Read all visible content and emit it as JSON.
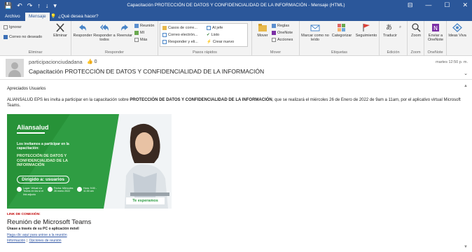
{
  "window": {
    "title": "Capacitación PROTECCIÓN DE DATOS Y CONFIDENCIALIDAD DE LA INFORMACIÓN  -  Mensaje (HTML)",
    "buttons": {
      "minimize": "—",
      "restore": "☐",
      "close": "✕",
      "options": "⊟"
    },
    "qat": [
      "💾",
      "↶",
      "↷",
      "↑",
      "↓",
      "▾"
    ]
  },
  "tabs": [
    {
      "label": "Archivo",
      "active": false
    },
    {
      "label": "Mensaje",
      "active": true
    }
  ],
  "tellme": {
    "icon": "lightbulb-icon",
    "text": "¿Qué desea hacer?"
  },
  "ribbon": {
    "eliminar": {
      "label": "Eliminar",
      "ignorar": "Ignorar",
      "correo_no_deseado": "Correo no deseado",
      "eliminar": "Eliminar"
    },
    "responder": {
      "label": "Responder",
      "responder": "Responder",
      "responder_todos": "Responder a todos",
      "reenviar": "Reenviar",
      "reunion": "Reunión",
      "mi": "MI",
      "mas": "Más"
    },
    "pasos_rapidos": {
      "label": "Pasos rápidos",
      "items": [
        "Casos de corre...",
        "Al jefe",
        "Correo electrón...",
        "Listo",
        "Responder y eli...",
        "Crear nuevo"
      ]
    },
    "mover": {
      "label": "Mover",
      "mover": "Mover",
      "reglas": "Reglas",
      "onenote": "OneNote",
      "acciones": "Acciones"
    },
    "etiquetas": {
      "label": "Etiquetas",
      "no_leido": "Marcar como no leído",
      "categorizar": "Categorizar",
      "seguimiento": "Seguimiento"
    },
    "edicion": {
      "label": "Edición",
      "traducir": "Traducir"
    },
    "zoom": {
      "label": "Zoom",
      "zoom": "Zoom"
    },
    "onenote": {
      "label": "OneNote",
      "enviar": "Enviar a OneNote"
    },
    "ideas": {
      "label": "Ideas Viva"
    }
  },
  "message": {
    "sender": "participacionciudadana",
    "likes": "0",
    "subject": "Capacitación PROTECCIÓN DE DATOS Y CONFIDENCIALIDAD DE LA INFORMACIÓN",
    "time": "martes 12:50 p. m."
  },
  "body": {
    "greeting": "Apreciados Usuarios",
    "para_start": "ALIANSALUD EPS les invita a  participar en la capacitación sobre ",
    "para_bold": "PROTECCIÓN DE DATOS Y CONFIDENCIALIDAD DE LA INFORMACIÓN",
    "para_end": ", que se realizará el miércoles 26 de Enero de 2022 de 9am a 11am, por el aplicativo virtual Microsoft Teams."
  },
  "banner": {
    "logo": "Aliansalud",
    "invite": "Los invitamos a participar en la capacitación:",
    "topic": "PROTECCIÓN DE DATOS Y CONFIDENCIALIDAD DE LA INFORMACIÓN",
    "dirigido": "Dirigido a: usuarios",
    "lugar": "Lugar: Virtual vía Teams en los sí el link adjunto",
    "fecha": "Fecha: Miércoles 26 enero 2022",
    "hora": "Hora: 9:00 - 11:00 am",
    "cta": "Te esperamos"
  },
  "teams": {
    "link_heading": "LINK DE CONEXIÓN:",
    "meeting_title": "Reunión de Microsoft Teams",
    "join_from": "Únase a través de su PC o aplicación móvil",
    "join_link": "Haga clic aquí para unirse a la reunión",
    "more_info": "Información",
    "separator": "|",
    "options": "Opciones de reunión"
  },
  "colors": {
    "titlebar": "#2b579a",
    "banner_green": "#2f9d43",
    "link_blue": "#3358a5",
    "alert_red": "#c00000"
  }
}
